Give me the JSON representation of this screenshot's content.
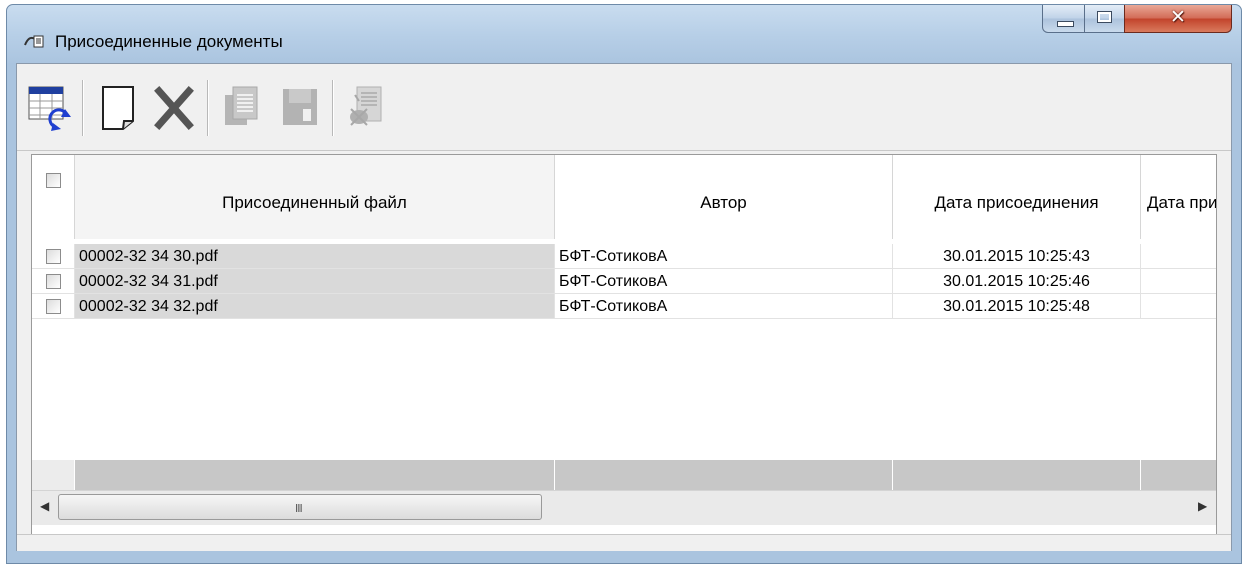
{
  "window": {
    "title": "Присоединенные документы"
  },
  "toolbar": {
    "buttons": [
      {
        "name": "refresh-table",
        "icon": "table-refresh-icon",
        "enabled": true
      },
      {
        "name": "new-document",
        "icon": "new-page-icon",
        "enabled": true
      },
      {
        "name": "delete",
        "icon": "delete-x-icon",
        "enabled": true
      },
      {
        "name": "copy",
        "icon": "copy-document-icon",
        "enabled": false
      },
      {
        "name": "save",
        "icon": "save-floppy-icon",
        "enabled": false
      },
      {
        "name": "attach",
        "icon": "attach-document-icon",
        "enabled": false
      }
    ]
  },
  "grid": {
    "columns": [
      {
        "label": ""
      },
      {
        "label": "Присоединенный файл"
      },
      {
        "label": "Автор"
      },
      {
        "label": "Дата присоединения"
      },
      {
        "label": "Дата при"
      }
    ],
    "rows": [
      {
        "checked": false,
        "file": "00002-32 34 30.pdf",
        "author": "БФТ-СотиковА",
        "date": "30.01.2015 10:25:43",
        "date2": ""
      },
      {
        "checked": false,
        "file": "00002-32 34 31.pdf",
        "author": "БФТ-СотиковА",
        "date": "30.01.2015 10:25:46",
        "date2": ""
      },
      {
        "checked": false,
        "file": "00002-32 34 32.pdf",
        "author": "БФТ-СотиковА",
        "date": "30.01.2015 10:25:48",
        "date2": ""
      }
    ]
  },
  "scrollbar": {
    "left_arrow": "◀",
    "right_arrow": "▶",
    "grip": "III"
  },
  "colors": {
    "title_bar": "#b7cfe7",
    "close_button": "#c2432b",
    "toolbar_bg": "#f0f0f0",
    "file_column_bg": "#d9d9d9",
    "footer_bg": "#c7c7c7"
  }
}
